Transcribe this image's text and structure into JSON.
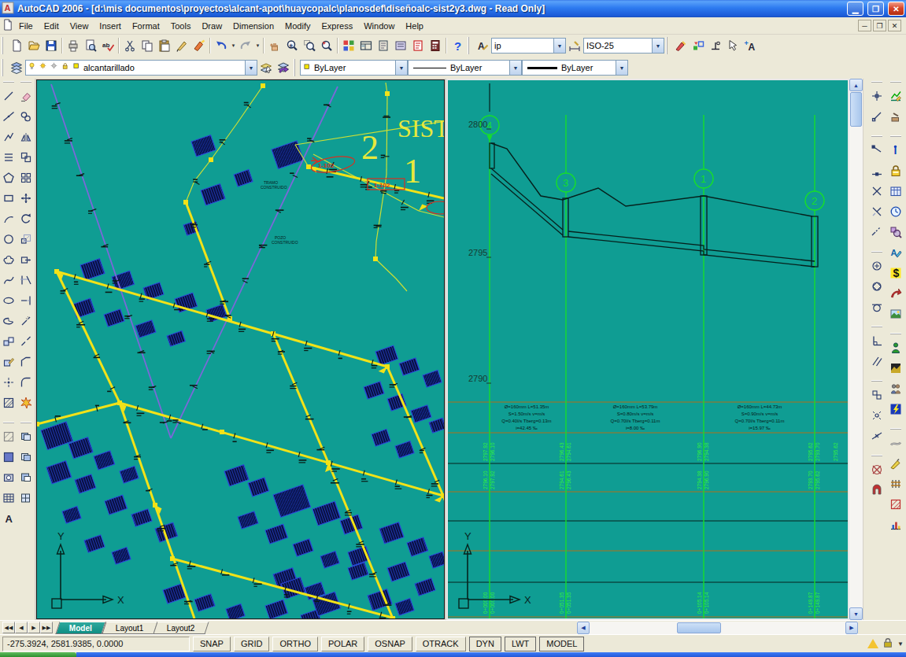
{
  "window": {
    "title": "AutoCAD 2006 - [d:\\mis documentos\\proyectos\\alcant-apot\\huaycopalc\\planosdef\\diseñoalc-sist2y3.dwg - Read Only]"
  },
  "menus": [
    "File",
    "Edit",
    "View",
    "Insert",
    "Format",
    "Tools",
    "Draw",
    "Dimension",
    "Modify",
    "Express",
    "Window",
    "Help"
  ],
  "toolbar_main": {
    "icons": [
      "new",
      "open",
      "save",
      "plot",
      "preview",
      "spell",
      "cut",
      "copy",
      "paste",
      "brush",
      "match-properties",
      "undo",
      "redo",
      "pan",
      "zoom-realtime",
      "zoom-window",
      "zoom-previous",
      "properties",
      "design-center",
      "tool-palettes",
      "sheet-set",
      "markup",
      "quick-calc",
      "help"
    ]
  },
  "toolbar_styles": {
    "text_style_value": "ip",
    "dim_style_value": "ISO-25",
    "icons": [
      "text-style",
      "dim-style"
    ]
  },
  "toolbar_extra": {
    "icons": [
      "sketch",
      "shapes",
      "dim-ordinate",
      "select-pen",
      "add-text"
    ]
  },
  "layers_toolbar": {
    "layer_value": "alcantarillado",
    "icons": [
      "layer-manager",
      "make-layer-current",
      "layer-previous"
    ],
    "state_icons": [
      "bulb",
      "sun",
      "sun-vp",
      "lock",
      "swatch"
    ]
  },
  "properties_toolbar": {
    "color_value": "ByLayer",
    "linetype_value": "ByLayer",
    "lineweight_value": "ByLayer"
  },
  "draw_toolbar": {
    "icons": [
      "line",
      "construction-line",
      "polyline",
      "multiline",
      "polygon",
      "rectangle",
      "arc",
      "circle",
      "revcloud",
      "spline",
      "ellipse",
      "ellipse-arc",
      "insert-block",
      "make-block",
      "point",
      "hatch",
      "hatch-edit",
      "gradient",
      "region",
      "table",
      "mtext"
    ]
  },
  "modify_toolbar": {
    "icons": [
      "erase",
      "copy-object",
      "mirror",
      "offset",
      "array",
      "move",
      "rotate",
      "scale",
      "stretch",
      "trim",
      "extend",
      "break-point",
      "break",
      "chamfer",
      "fillet",
      "explode",
      "vport-1",
      "vport-2",
      "vport-3",
      "vport-4"
    ]
  },
  "osnap_toolbar": {
    "icons": [
      "track-point",
      "snap-from",
      "endpoint",
      "midpoint",
      "intersection",
      "apparent-int",
      "extension",
      "center",
      "quadrant",
      "tangent",
      "perpendicular",
      "parallel",
      "insert-point",
      "node",
      "nearest",
      "none",
      "osnap-settings"
    ]
  },
  "misc_toolbar": {
    "icons": [
      "sketch-chart",
      "hand-tool",
      "info",
      "lock-tool",
      "table-tool",
      "clock",
      "render-zoom",
      "text-pen",
      "dollar",
      "red-arrow",
      "image",
      "green-man",
      "terrain",
      "pair",
      "lightning",
      "pipe",
      "pen-yellow",
      "fence",
      "hatch-red",
      "chart-colors"
    ]
  },
  "tabs": [
    "Model",
    "Layout1",
    "Layout2"
  ],
  "status": {
    "coords": "-275.3924, 2581.9385, 0.0000",
    "buttons": [
      "SNAP",
      "GRID",
      "ORTHO",
      "POLAR",
      "OSNAP",
      "OTRACK",
      "DYN",
      "LWT",
      "MODEL"
    ]
  },
  "plan_view": {
    "big_label": "SIST",
    "num_2": "2",
    "num_1": "1",
    "red_ellipse_label": "1-102",
    "red_box_label": "1-102",
    "note_1a": "TRAMO",
    "note_1b": "CONSTRUIDO",
    "note_2a": "POZO",
    "note_2b": "CONSTRUIDO",
    "axis_x": "X",
    "axis_y": "Y"
  },
  "profile_view": {
    "elevations": [
      "2800",
      "2795",
      "2790"
    ],
    "manhole_numbers": [
      "4",
      "3",
      "1",
      "2"
    ],
    "ground_labels": [
      "2797.92",
      "2796.43",
      "2796.90",
      "2795.62"
    ],
    "invert_labels": [
      "2796.10",
      "2794.61",
      "2794.38",
      "2793.70"
    ],
    "station_labels": [
      "0+000.00",
      "0+051.35",
      "0+105.14",
      "0+149.87"
    ],
    "segments": [
      {
        "l1": "Ø=160mm  L=51.35m",
        "l2": "S=1.50m/s  v=m/s",
        "l3": "Q=0.40l/s  Tberg=0.13m",
        "l4": "i=42.45 ‰"
      },
      {
        "l1": "Ø=160mm  L=53.79m",
        "l2": "S=0.80m/s  v=m/s",
        "l3": "Q=0.70l/s  Tberg=0.11m",
        "l4": "i=8.00 ‰"
      },
      {
        "l1": "Ø=160mm  L=44.73m",
        "l2": "S=0.90m/s  v=m/s",
        "l3": "Q=0.70l/s  Tberg=0.11m",
        "l4": "i=15.97 ‰"
      }
    ],
    "axis_x": "X",
    "axis_y": "Y"
  }
}
